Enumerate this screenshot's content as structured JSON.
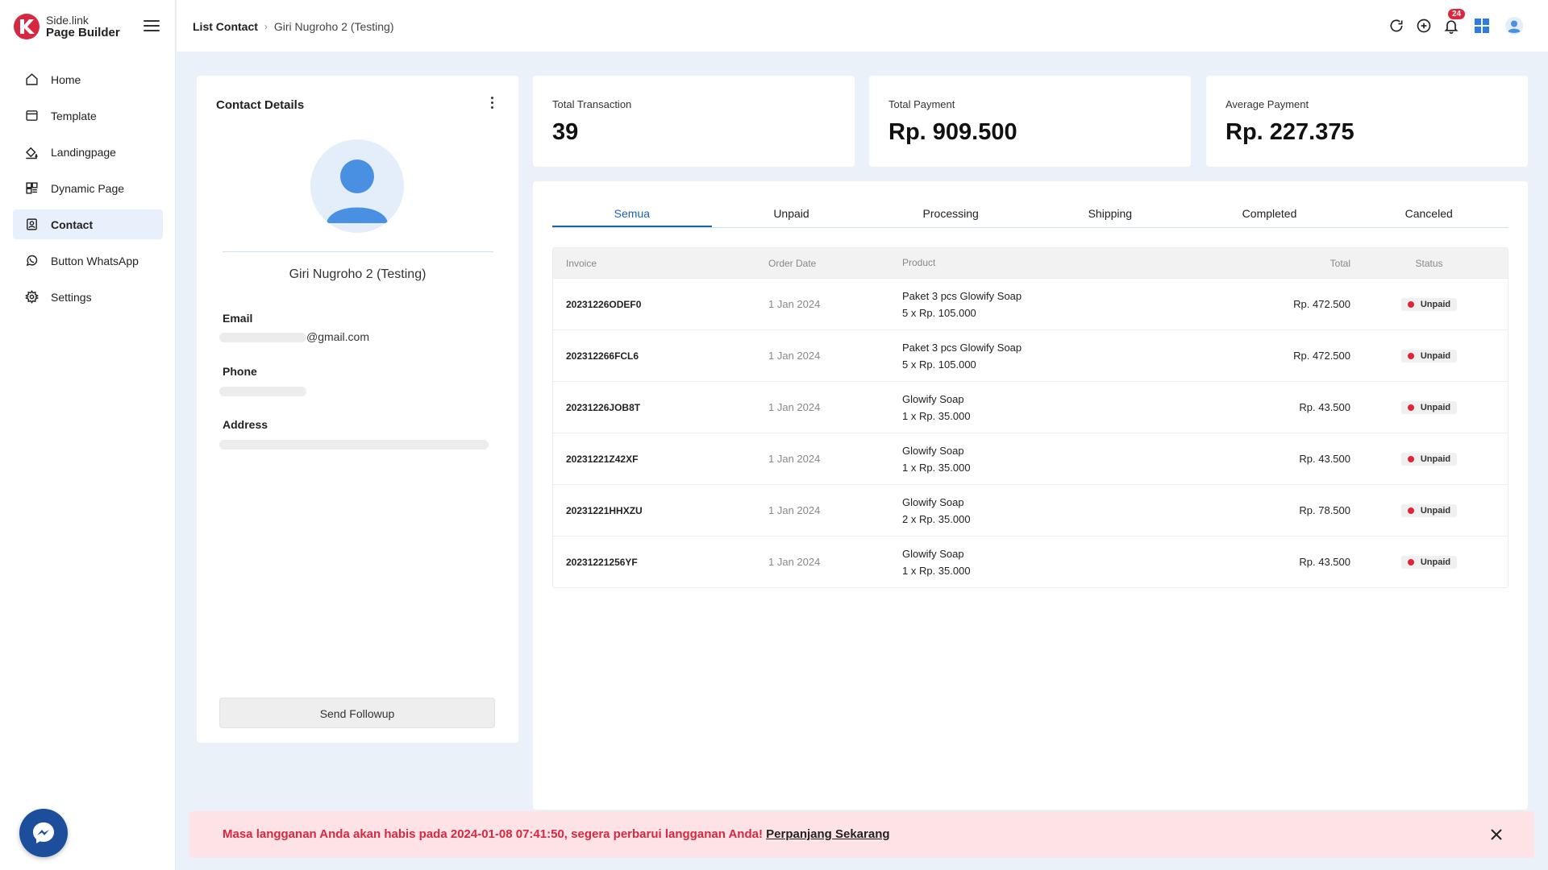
{
  "brand": {
    "top": "Side.link",
    "bottom": "Page Builder"
  },
  "colors": {
    "accent": "#1b63b3",
    "danger": "#e0243b",
    "alert_bg": "#fde3e6",
    "brand_red": "#d62840"
  },
  "sidebar": {
    "items": [
      {
        "label": "Home",
        "icon": "home-icon"
      },
      {
        "label": "Template",
        "icon": "template-icon"
      },
      {
        "label": "Landingpage",
        "icon": "paint-bucket-icon"
      },
      {
        "label": "Dynamic Page",
        "icon": "dashboard-icon"
      },
      {
        "label": "Contact",
        "icon": "contact-icon",
        "active": true
      },
      {
        "label": "Button WhatsApp",
        "icon": "whatsapp-icon"
      },
      {
        "label": "Settings",
        "icon": "gear-icon"
      }
    ]
  },
  "header": {
    "breadcrumb_root": "List Contact",
    "breadcrumb_current": "Giri Nugroho 2 (Testing)",
    "notification_count": "24",
    "icons": [
      "refresh-icon",
      "add-circle-icon",
      "bell-icon",
      "apps-grid-icon",
      "user-avatar-icon"
    ]
  },
  "contact": {
    "title": "Contact Details",
    "name": "Giri Nugroho 2 (Testing)",
    "email_label": "Email",
    "email_value": "@gmail.com",
    "phone_label": "Phone",
    "address_label": "Address",
    "send_button": "Send Followup"
  },
  "stats": {
    "total_transaction_label": "Total Transaction",
    "total_transaction_value": "39",
    "total_payment_label": "Total Payment",
    "total_payment_value": "Rp. 909.500",
    "average_payment_label": "Average Payment",
    "average_payment_value": "Rp. 227.375"
  },
  "tabs": [
    "Semua",
    "Unpaid",
    "Processing",
    "Shipping",
    "Completed",
    "Canceled"
  ],
  "table": {
    "headers": {
      "invoice": "Invoice",
      "date": "Order Date",
      "product": "Product",
      "total": "Total",
      "status": "Status"
    },
    "rows": [
      {
        "invoice": "20231226ODEF0",
        "date": "1 Jan 2024",
        "product": "Paket 3 pcs Glowify Soap",
        "qty": "5 x Rp. 105.000",
        "total": "Rp. 472.500",
        "status": "Unpaid"
      },
      {
        "invoice": "202312266FCL6",
        "date": "1 Jan 2024",
        "product": "Paket 3 pcs Glowify Soap",
        "qty": "5 x Rp. 105.000",
        "total": "Rp. 472.500",
        "status": "Unpaid"
      },
      {
        "invoice": "20231226JOB8T",
        "date": "1 Jan 2024",
        "product": "Glowify Soap",
        "qty": "1 x Rp. 35.000",
        "total": "Rp. 43.500",
        "status": "Unpaid"
      },
      {
        "invoice": "20231221Z42XF",
        "date": "1 Jan 2024",
        "product": "Glowify Soap",
        "qty": "1 x Rp. 35.000",
        "total": "Rp. 43.500",
        "status": "Unpaid"
      },
      {
        "invoice": "20231221HHXZU",
        "date": "1 Jan 2024",
        "product": "Glowify Soap",
        "qty": "2 x Rp. 35.000",
        "total": "Rp. 78.500",
        "status": "Unpaid"
      },
      {
        "invoice": "20231221256YF",
        "date": "1 Jan 2024",
        "product": "Glowify Soap",
        "qty": "1 x Rp. 35.000",
        "total": "Rp. 43.500",
        "status": "Unpaid"
      }
    ]
  },
  "alert": {
    "message": "Masa langganan Anda akan habis pada 2024-01-08 07:41:50, segera perbarui langganan Anda! ",
    "link": "Perpanjang Sekarang"
  }
}
